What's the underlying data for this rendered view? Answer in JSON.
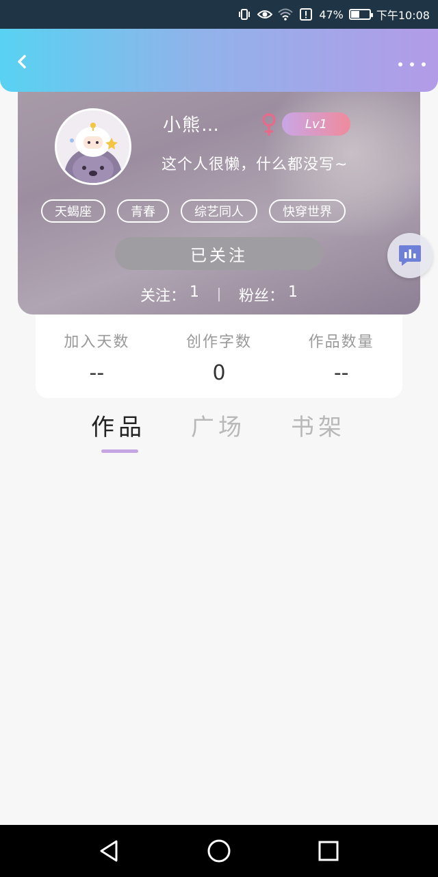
{
  "status_bar": {
    "battery_percent_text": "47%",
    "time": "下午10:08",
    "battery_level": 0.47
  },
  "profile": {
    "username": "小熊…",
    "level": "Lv1",
    "bio": "这个人很懒，什么都没写~",
    "tags": [
      "天蝎座",
      "青春",
      "综艺同人",
      "快穿世界"
    ],
    "follow_button_label": "已关注",
    "following_label": "关注：",
    "following_count": "1",
    "followers_label": "粉丝：",
    "followers_count": "1"
  },
  "stats": [
    {
      "label": "加入天数",
      "value": "--"
    },
    {
      "label": "创作字数",
      "value": "0"
    },
    {
      "label": "作品数量",
      "value": "--"
    }
  ],
  "tabs": [
    {
      "label": "作品",
      "active": true
    },
    {
      "label": "广场",
      "active": false
    },
    {
      "label": "书架",
      "active": false
    }
  ],
  "colors": {
    "header_gradient_start": "#58d2f2",
    "header_gradient_end": "#b39be7",
    "level_badge_start": "#c9a6e6",
    "level_badge_end": "#ef8b9c",
    "tab_indicator": "#c5a5e2",
    "gender_icon": "#e56b8b"
  },
  "icons": {
    "back": "chevron-left-icon",
    "more": "more-dots-icon",
    "gender": "female-icon",
    "float": "chart-chat-icon",
    "nav_back": "triangle-back-icon",
    "nav_home": "circle-home-icon",
    "nav_recent": "square-recent-icon"
  }
}
